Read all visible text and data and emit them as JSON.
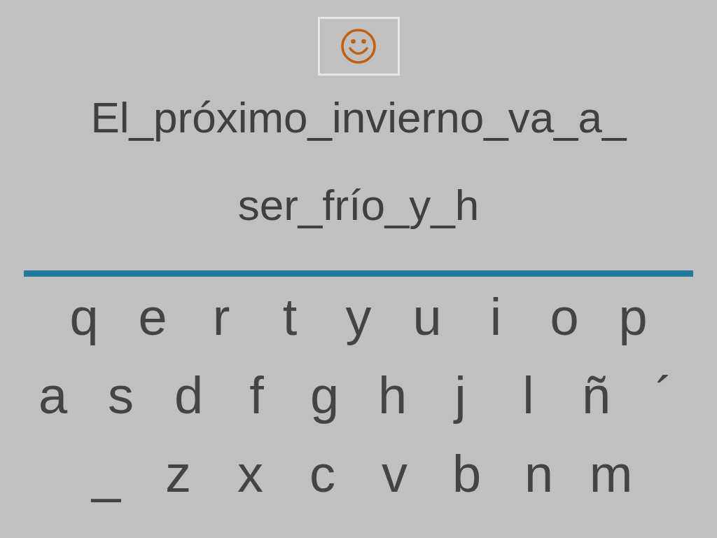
{
  "prompt_lines": [
    "El_próximo_invierno_va_a_",
    "ser_frío_y_h"
  ],
  "keyboard_rows": [
    [
      "q",
      "e",
      "r",
      "t",
      "y",
      "u",
      "i",
      "o",
      "p"
    ],
    [
      "a",
      "s",
      "d",
      "f",
      "g",
      "h",
      "j",
      "l",
      "ñ",
      "´"
    ],
    [
      "_",
      "z",
      "x",
      "c",
      "v",
      "b",
      "n",
      "m"
    ]
  ]
}
